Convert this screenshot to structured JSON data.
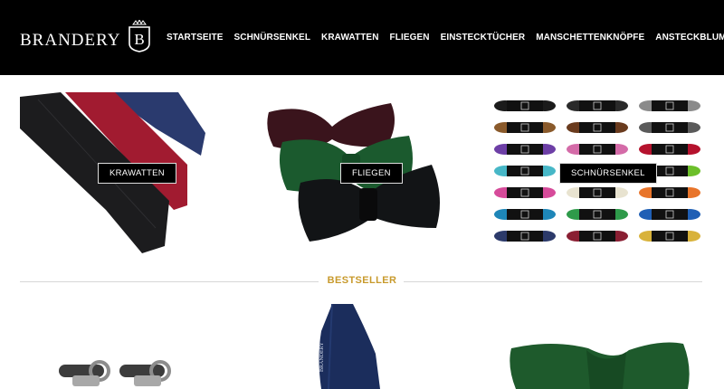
{
  "brand": {
    "name": "BRANDERY",
    "badge_letter": "B"
  },
  "nav": [
    "STARTSEITE",
    "SCHNÜRSENKEL",
    "KRAWATTEN",
    "FLIEGEN",
    "EINSTECKTÜCHER",
    "MANSCHETTENKNÖPFE",
    "ANSTECKBLUMEN"
  ],
  "categories": [
    {
      "label": "KRAWATTEN",
      "image": "ties-photo"
    },
    {
      "label": "FLIEGEN",
      "image": "bowties-photo"
    },
    {
      "label": "SCHNÜRSENKEL",
      "image": "shoelaces-photo"
    }
  ],
  "section": {
    "title": "BESTSELLER"
  },
  "colors": {
    "header_bg": "#000000",
    "accent": "#c89a2c",
    "text_light": "#ffffff"
  },
  "products": [
    {
      "image": "cufflinks-photo"
    },
    {
      "image": "pocket-square-photo",
      "print": "BRANDERY"
    },
    {
      "image": "green-bowtie-photo"
    }
  ]
}
